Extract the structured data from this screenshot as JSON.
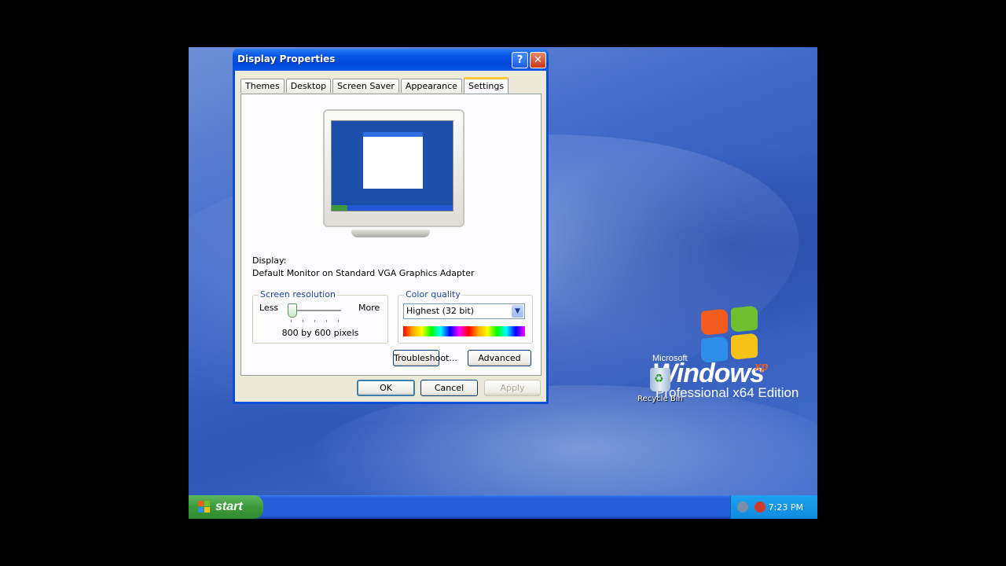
{
  "desktop": {
    "logo": {
      "microsoft": "Microsoft",
      "windows": "Windows",
      "xp": "xp",
      "edition": "Professional x64 Edition"
    },
    "recycle_bin_label": "Recycle Bin"
  },
  "taskbar": {
    "start_label": "start",
    "clock": "7:23 PM"
  },
  "dialog": {
    "title": "Display Properties",
    "help_button": "?",
    "close_button": "✕",
    "tabs": [
      {
        "label": "Themes"
      },
      {
        "label": "Desktop"
      },
      {
        "label": "Screen Saver"
      },
      {
        "label": "Appearance"
      },
      {
        "label": "Settings",
        "active": true
      }
    ],
    "display_label": "Display:",
    "display_value": "Default Monitor on Standard VGA Graphics Adapter",
    "screen_resolution": {
      "title": "Screen resolution",
      "less": "Less",
      "more": "More",
      "value": "800 by 600 pixels",
      "slider_position": 0
    },
    "color_quality": {
      "title": "Color quality",
      "selected": "Highest (32 bit)"
    },
    "buttons": {
      "troubleshoot": "Troubleshoot...",
      "advanced": "Advanced",
      "ok": "OK",
      "cancel": "Cancel",
      "apply": "Apply"
    }
  },
  "colors": {
    "titlebar": "#0a57e4",
    "dialog_bg": "#ece9d8",
    "start_green": "#3c9a3c",
    "active_tab_accent": "#ffc83c"
  }
}
